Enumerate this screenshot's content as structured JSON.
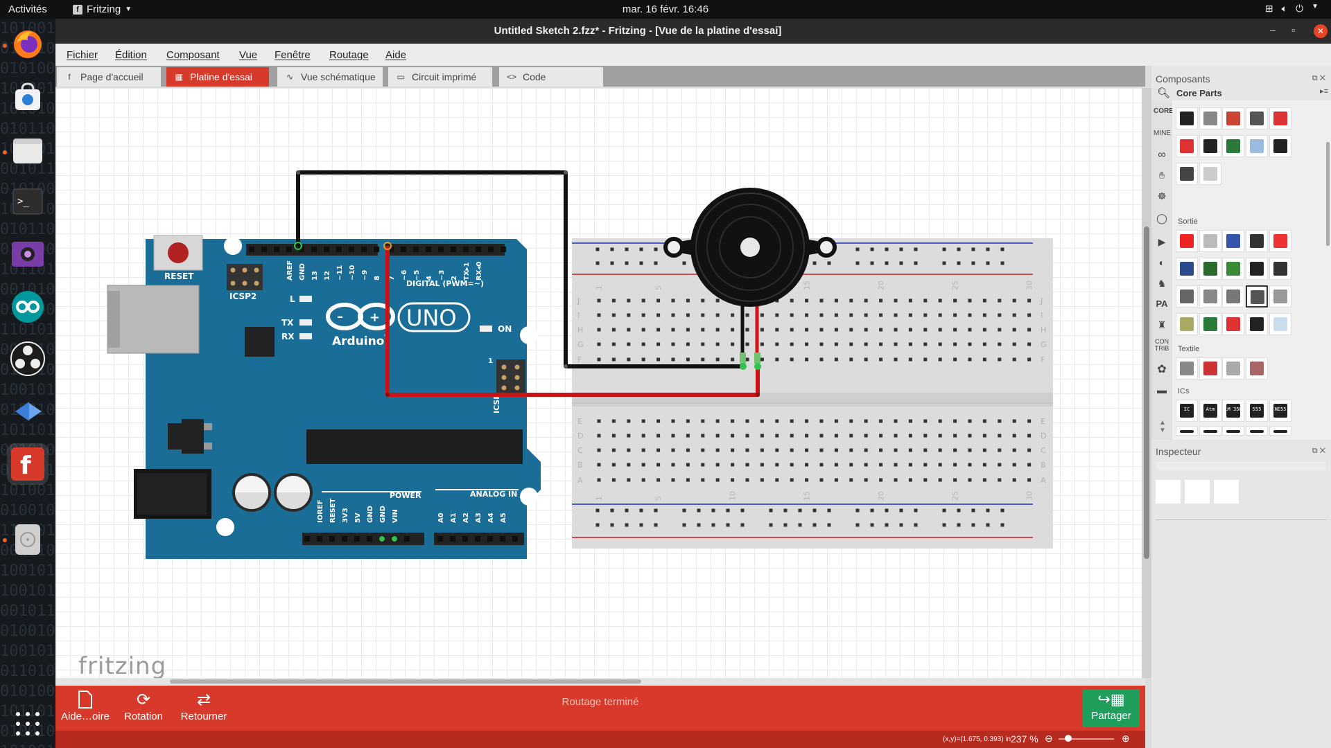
{
  "topbar": {
    "activities": "Activités",
    "app_name": "Fritzing",
    "clock": "mar. 16 févr.  16:46"
  },
  "window": {
    "title": "Untitled Sketch 2.fzz* - Fritzing - [Vue de la platine d'essai]"
  },
  "menu": [
    "Fichier",
    "Édition",
    "Composant",
    "Vue",
    "Fenêtre",
    "Routage",
    "Aide"
  ],
  "tabs": [
    "Page d'accueil",
    "Platine d'essai",
    "Vue schématique",
    "Circuit imprimé",
    "Code"
  ],
  "active_tab": "Platine d'essai",
  "canvas": {
    "logo": "fritzing",
    "arduino": {
      "reset_label": "RESET",
      "icsp2_label": "ICSP2",
      "icsp_label": "ICSP",
      "uno_label": "UNO",
      "brand_label": "Arduino",
      "tm": "™",
      "digital_label": "DIGITAL (PWM=~)",
      "on_label": "ON",
      "l_label": "L",
      "tx_label": "TX",
      "rx_label": "RX",
      "power_label": "POWER",
      "analog_label": "ANALOG IN",
      "digital_pins": [
        "AREF",
        "GND",
        "13",
        "12",
        "~11",
        "~10",
        "~9",
        "8",
        "7",
        "~6",
        "~5",
        "4",
        "~3",
        "2",
        "TX▸1",
        "RX◂0"
      ],
      "power_pins": [
        "IOREF",
        "RESET",
        "3V3",
        "5V",
        "GND",
        "GND",
        "VIN"
      ],
      "analog_pins": [
        "A0",
        "A1",
        "A2",
        "A3",
        "A4",
        "A5"
      ],
      "icsp_one": "1"
    },
    "breadboard": {
      "rows_top": [
        "J",
        "I",
        "H",
        "G",
        "F"
      ],
      "rows_bottom": [
        "E",
        "D",
        "C",
        "B",
        "A"
      ],
      "col_numbers": [
        "1",
        "5",
        "10",
        "15",
        "20",
        "25",
        "30"
      ]
    }
  },
  "toolbar": {
    "buttons": [
      {
        "label": "Aide…oire",
        "icon": "document-icon"
      },
      {
        "label": "Rotation",
        "icon": "rotate-icon"
      },
      {
        "label": "Retourner",
        "icon": "flip-icon"
      }
    ],
    "status": "Routage terminé",
    "share": "Partager"
  },
  "statusbar": {
    "coords": "(x,y)=(1.675, 0.393) in",
    "zoom": "237 %"
  },
  "parts_panel": {
    "title": "Composants",
    "bin": "Core Parts",
    "sidebar": [
      "CORE",
      "MINE"
    ],
    "sections": [
      "Sortie",
      "Textile",
      "ICs"
    ],
    "ic_labels": [
      "IC",
      "Atm",
      "LM 358",
      "555",
      "NE55"
    ]
  },
  "inspector": {
    "title": "Inspecteur"
  },
  "colors": {
    "accent": "#d7392b",
    "board": "#1a6d97",
    "share": "#1f9e5c"
  }
}
